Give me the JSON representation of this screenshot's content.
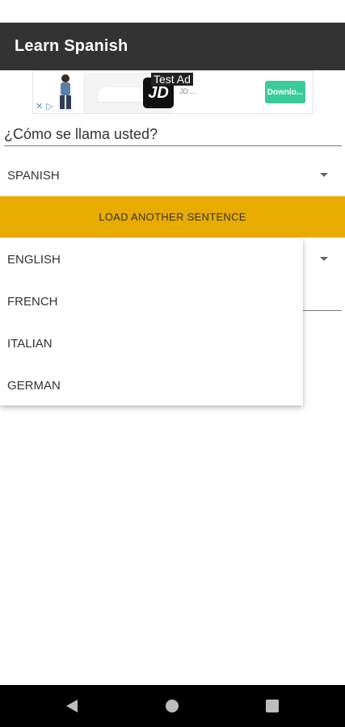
{
  "app": {
    "title": "Learn Spanish"
  },
  "ad": {
    "label": "Test Ad",
    "logo": "JD",
    "brand_fragment": "JD ...",
    "cta": "Downlo..."
  },
  "sentence": {
    "text": "¿Cómo se llama usted?"
  },
  "source_language": {
    "selected": "SPANISH"
  },
  "load_button": {
    "label": "LOAD ANOTHER SENTENCE"
  },
  "target_language": {
    "options": [
      "ENGLISH",
      "FRENCH",
      "ITALIAN",
      "GERMAN"
    ]
  },
  "icons": {
    "dropdown_arrow": "dropdown-arrow-icon",
    "nav_back": "back-icon",
    "nav_home": "home-icon",
    "nav_recents": "recents-icon"
  },
  "colors": {
    "appbar": "#333333",
    "accent": "#e8ab00",
    "navbar": "#000000"
  }
}
